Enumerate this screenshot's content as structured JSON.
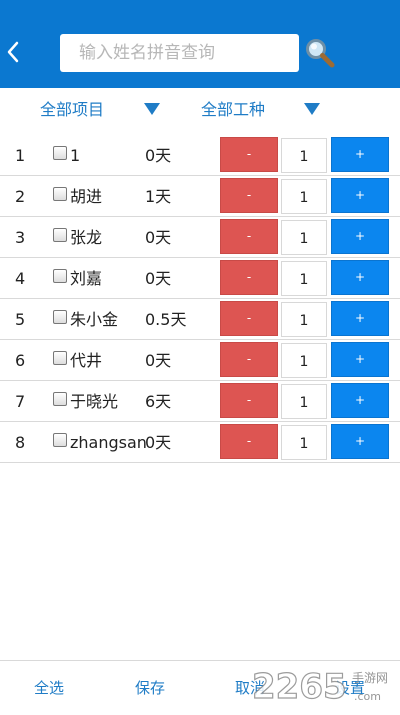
{
  "header": {
    "search_placeholder": "输入姓名拼音查询",
    "back_icon": "chevron-left-icon",
    "search_icon": "magnifier-icon"
  },
  "filters": {
    "project": "全部项目",
    "work_type": "全部工种"
  },
  "rows": [
    {
      "index": "1",
      "name": "1",
      "days": "0天",
      "minus": "-",
      "qty": "1",
      "plus": "+"
    },
    {
      "index": "2",
      "name": "胡进",
      "days": "1天",
      "minus": "-",
      "qty": "1",
      "plus": "+"
    },
    {
      "index": "3",
      "name": "张龙",
      "days": "0天",
      "minus": "-",
      "qty": "1",
      "plus": "+"
    },
    {
      "index": "4",
      "name": "刘嘉",
      "days": "0天",
      "minus": "-",
      "qty": "1",
      "plus": "+"
    },
    {
      "index": "5",
      "name": "朱小金",
      "days": "0.5天",
      "minus": "-",
      "qty": "1",
      "plus": "+"
    },
    {
      "index": "6",
      "name": "代井",
      "days": "0天",
      "minus": "-",
      "qty": "1",
      "plus": "+"
    },
    {
      "index": "7",
      "name": "于晓光",
      "days": "6天",
      "minus": "-",
      "qty": "1",
      "plus": "+"
    },
    {
      "index": "8",
      "name": "zhangsan",
      "days": "0天",
      "minus": "-",
      "qty": "1",
      "plus": "+"
    }
  ],
  "footer": {
    "select_all": "全选",
    "save": "保存",
    "cancel": "取消",
    "settings": "设置"
  },
  "watermark": {
    "brand": "2265",
    "sub": "手游网",
    "domain": ".com"
  },
  "colors": {
    "primary": "#0b78d0",
    "minus_red": "#dd5552",
    "plus_blue": "#0b86ef",
    "link_blue": "#1f7cc6"
  }
}
